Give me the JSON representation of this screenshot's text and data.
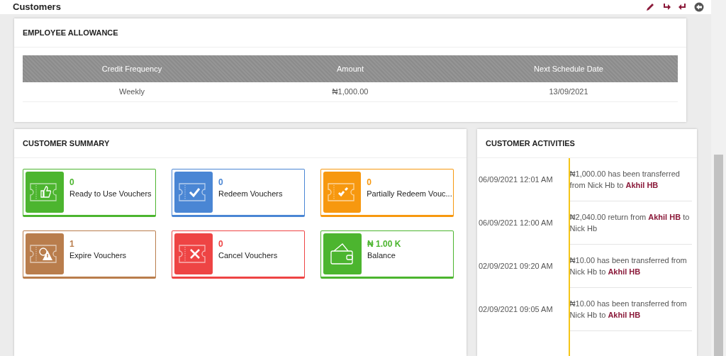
{
  "page_title": "Customers",
  "allowance": {
    "title": "EMPLOYEE ALLOWANCE",
    "columns": [
      "Credit Frequency",
      "Amount",
      "Next Schedule Date"
    ],
    "rows": [
      [
        "Weekly",
        "₦1,000.00",
        "13/09/2021"
      ]
    ]
  },
  "summary": {
    "title": "CUSTOMER SUMMARY",
    "tiles": [
      {
        "kind": "ready",
        "color": "#4cb52f",
        "count": "0",
        "label": "Ready to Use Vouchers"
      },
      {
        "kind": "redeem",
        "color": "#4a86d4",
        "count": "0",
        "label": "Redeem Vouchers"
      },
      {
        "kind": "partial",
        "color": "#f7980f",
        "count": "0",
        "label": "Partially Redeem Vouc..."
      },
      {
        "kind": "expire",
        "color": "#b97d4c",
        "count": "1",
        "label": "Expire Vouchers"
      },
      {
        "kind": "cancel",
        "color": "#ee4444",
        "count": "0",
        "label": "Cancel Vouchers"
      },
      {
        "kind": "balance",
        "color": "#4cb52f",
        "count": "₦ 1.00 K",
        "label": "Balance"
      }
    ]
  },
  "activities": {
    "title": "CUSTOMER ACTIVITIES",
    "items": [
      {
        "time": "06/09/2021 12:01 AM",
        "text": "₦1,000.00 has been transferred from Nick Hb to **Akhil HB**"
      },
      {
        "time": "06/09/2021 12:00 AM",
        "text": "₦2,040.00 return from **Akhil HB** to Nick Hb"
      },
      {
        "time": "02/09/2021 09:20 AM",
        "text": "₦10.00 has been transferred from Nick Hb to **Akhil HB**"
      },
      {
        "time": "02/09/2021 09:05 AM",
        "text": "₦10.00 has been transferred from Nick Hb to **Akhil HB**"
      }
    ]
  }
}
